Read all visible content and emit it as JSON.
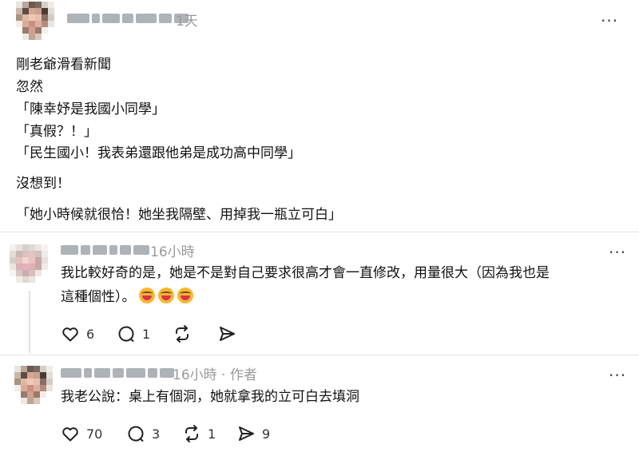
{
  "post": {
    "time": "1天",
    "more": "···",
    "lines": [
      "剛老爺滑看新聞",
      "忽然",
      "「陳幸妤是我國小同學」",
      "「真假？！」",
      "「民生國小！我表弟還跟他弟是成功高中同學」",
      "沒想到！",
      "「她小時候就很恰！她坐我隔壁、用掉我一瓶立可白」"
    ]
  },
  "replies": [
    {
      "time": "16小時",
      "more": "···",
      "text_line1": "我比較好奇的是，她是不是對自己要求很高才會一直修改，用量很大（因為我也是",
      "text_line2": "這種個性）。",
      "likes": "6",
      "comments": "1",
      "reposts": "",
      "shares": ""
    },
    {
      "time": "16小時 · 作者",
      "more": "···",
      "text_line1": "我老公說：桌上有個洞，她就拿我的立可白去填洞",
      "likes": "70",
      "comments": "3",
      "reposts": "1",
      "shares": "9"
    }
  ],
  "icons": {
    "like": "heart-icon",
    "comment": "comment-icon",
    "repost": "repost-icon",
    "share": "share-icon",
    "emoji": "laughing-face-emoji"
  }
}
